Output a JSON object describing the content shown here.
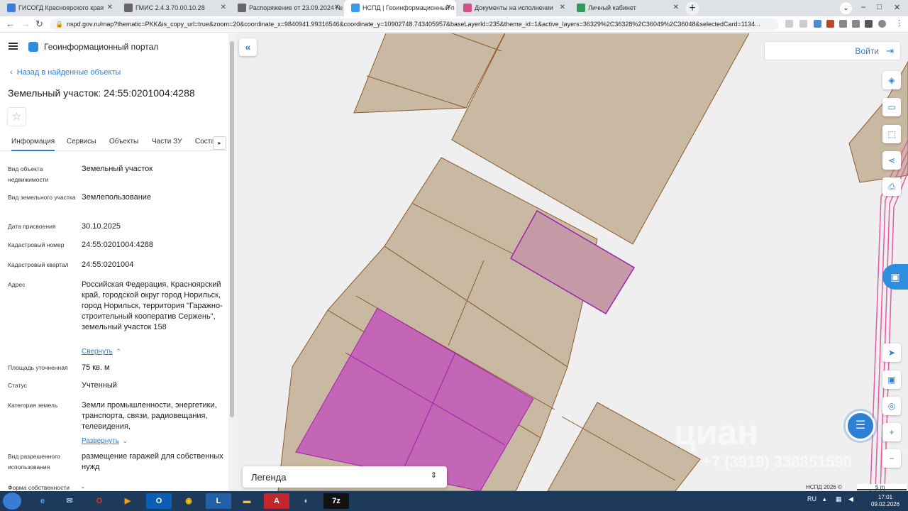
{
  "browser": {
    "tabs": [
      {
        "title": "ГИСОГД Красноярского края",
        "color": "#3b7ddd"
      },
      {
        "title": "ГМИС 2.4.3.70.00.10.28",
        "color": "#666666"
      },
      {
        "title": "Распоряжение от 23.09.2024 №",
        "color": "#666666"
      },
      {
        "title": "НСПД | Геоинформационный п",
        "color": "#3b9be8"
      },
      {
        "title": "Документы на исполнении",
        "color": "#d24f8b"
      },
      {
        "title": "Личный кабинет",
        "color": "#2e9c58"
      }
    ],
    "url": "nspd.gov.ru/map?thematic=PKK&is_copy_url=true&zoom=20&coordinate_x=9840941.99316546&coordinate_y=10902748.743405957&baseLayerId=235&theme_id=1&active_layers=36329%2C36328%2C36049%2C36048&selectedCard=1134..."
  },
  "panel": {
    "portal_title": "Геоинформационный портал",
    "back_link": "Назад в найденные объекты",
    "object_title": "Земельный участок: 24:55:0201004:4288",
    "tabs": [
      "Информация",
      "Сервисы",
      "Объекты",
      "Части ЗУ",
      "Соста"
    ],
    "fields": [
      {
        "label": "Вид объекта недвижимости",
        "value": "Земельный участок"
      },
      {
        "label": "Вид земельного участка",
        "value": "Землепользование"
      },
      {
        "label": "Дата присвоения",
        "value": "30.10.2025"
      },
      {
        "label": "Кадастровый номер",
        "value": "24:55:0201004:4288"
      },
      {
        "label": "Кадастровый квартал",
        "value": "24:55:0201004"
      },
      {
        "label": "Адрес",
        "value": "Российская Федерация, Красноярский край, городской округ город Норильск, город Норильск, территория \"Гаражно-строительный кооператив Сержень\", земельный участок 158",
        "toggle": "Свернуть"
      },
      {
        "label": "Площадь уточненная",
        "value": "75 кв. м"
      },
      {
        "label": "Статус",
        "value": "Учтенный"
      },
      {
        "label": "Категория земель",
        "value": "Земли промышленности, энергетики, транспорта, связи, радиовещания, телевидения,",
        "toggle": "Развернуть"
      },
      {
        "label": "Вид разрешенного использования",
        "value": "размещение гаражей для собственных нужд"
      },
      {
        "label": "Форма собственности",
        "value": "-"
      }
    ]
  },
  "map": {
    "login": "Войти",
    "legend": "Легенда",
    "copyright": "НСПД 2026 ©",
    "scale": "5 m",
    "watermark": "циан",
    "watermark2": "+7 (3919) 338851590",
    "colors": {
      "parcel": "#c9b9a2",
      "selected": "#c98fa5",
      "highlight": "#c366b5",
      "border": "#8b5a2b"
    }
  },
  "taskbar": {
    "lang": "RU",
    "time": "17:01",
    "date": "09.02.2026"
  }
}
